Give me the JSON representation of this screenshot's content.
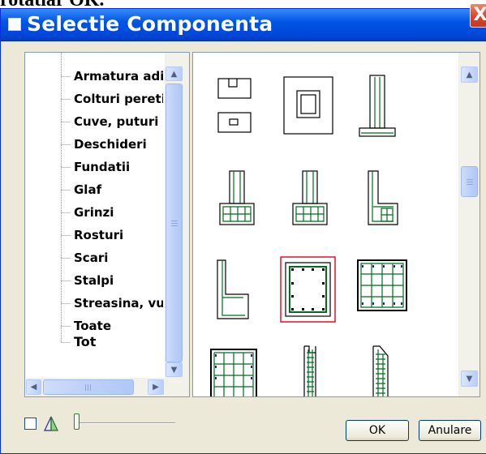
{
  "top_fragment": "rotatiar OK.",
  "window": {
    "title": "Selectie Componenta",
    "close_glyph": "X"
  },
  "tree": {
    "items": [
      {
        "label": "Armatura aditionala"
      },
      {
        "label": "Colturi pereti"
      },
      {
        "label": "Cuve, puturi"
      },
      {
        "label": "Deschideri"
      },
      {
        "label": "Fundatii"
      },
      {
        "label": "Glaf"
      },
      {
        "label": "Grinzi"
      },
      {
        "label": "Rosturi"
      },
      {
        "label": "Scari"
      },
      {
        "label": "Stalpi"
      },
      {
        "label": "Streasina, vuta"
      },
      {
        "label": "Toate"
      },
      {
        "label": "Tot",
        "selected": true
      }
    ],
    "scroll_up_icon": "arrow-up-icon",
    "scroll_down_icon": "arrow-down-icon",
    "scroll_left_icon": "arrow-left-icon",
    "scroll_right_icon": "arrow-right-icon"
  },
  "gallery": {
    "items": [
      {
        "name": "square-hole-pair-thumbnail"
      },
      {
        "name": "square-frame-thumbnail"
      },
      {
        "name": "column-footing-thumbnail"
      },
      {
        "name": "wall-footing-thumbnail"
      },
      {
        "name": "column-footing-narrow-thumbnail"
      },
      {
        "name": "l-wall-footing-thumbnail"
      },
      {
        "name": "l-wall-thumbnail"
      },
      {
        "name": "square-column-section-thumbnail",
        "selected": true
      },
      {
        "name": "rebar-grid-section-thumbnail"
      },
      {
        "name": "rebar-grid-large-thumbnail"
      },
      {
        "name": "rebar-cage-narrow-thumbnail"
      },
      {
        "name": "rebar-cage-chamfer-thumbnail"
      }
    ],
    "selection_color": "#e0001e",
    "rebar_color": "#006a1e"
  },
  "footer": {
    "ok_label": "OK",
    "cancel_label": "Anulare",
    "checkbox_checked": false,
    "view_icon": "perspective-icon",
    "zoom_slider_position": 0.0
  }
}
